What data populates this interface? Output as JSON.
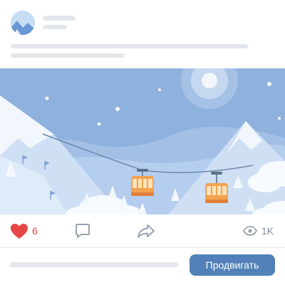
{
  "actions": {
    "likes": "6",
    "views": "1K"
  },
  "footer": {
    "promote_label": "Продвигать"
  },
  "colors": {
    "accent": "#5181b8",
    "like": "#e64646",
    "sky": "#8fb1de",
    "snow": "#eaf2fb",
    "placeholder": "#e3e6ea",
    "cabin": "#f4a24d"
  },
  "icons": [
    "heart-icon",
    "comment-icon",
    "share-icon",
    "eye-icon"
  ]
}
